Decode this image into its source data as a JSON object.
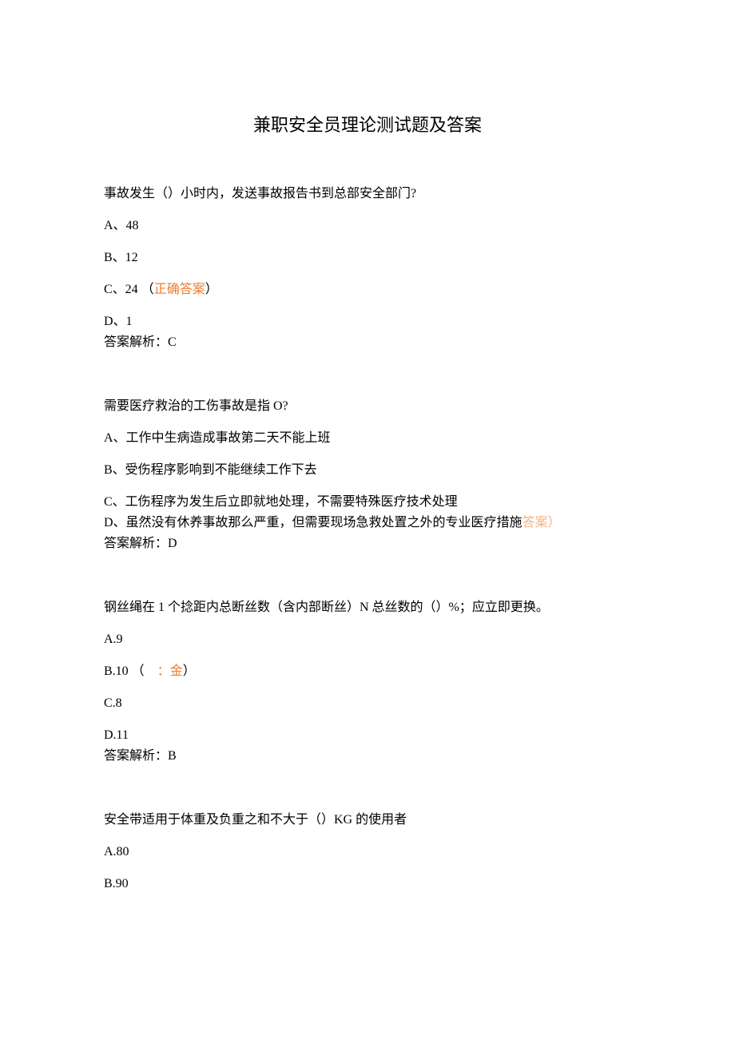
{
  "title": "兼职安全员理论测试题及答案",
  "q1": {
    "question": "事故发生（）小时内，发送事故报告书到总部安全部门?",
    "a": "A、48",
    "b": "B、12",
    "c_prefix": "C、24",
    "c_paren_open": "（",
    "c_ans": "正确答案",
    "c_paren_close": "）",
    "d": "D、1",
    "explain": "答案解析：C"
  },
  "q2": {
    "question": "需要医疗救治的工伤事故是指 O?",
    "a": "A、工作中生病造成事故第二天不能上班",
    "b": "B、受伤程序影响到不能继续工作下去",
    "c": "C、工伤程序为发生后立即就地处理，不需要特殊医疗技术处理",
    "d_main": "D、虽然没有休养事故那么严重，但需要现场急救处置之外的专业医疗措施",
    "d_ans": "答案）",
    "explain": "答案解析：D"
  },
  "q3": {
    "question": "钢丝绳在 1 个捻距内总断丝数（含内部断丝）N 总丝数的（）%；应立即更换。",
    "a": "A.9",
    "b_prefix": "B.10",
    "b_paren_open": "（",
    "b_mid": "：金",
    "b_paren_close": "）",
    "c": "C.8",
    "d": "D.11",
    "explain": "答案解析：B"
  },
  "q4": {
    "question": "安全带适用于体重及负重之和不大于（）KG 的使用者",
    "a": "A.80",
    "b": "B.90"
  }
}
